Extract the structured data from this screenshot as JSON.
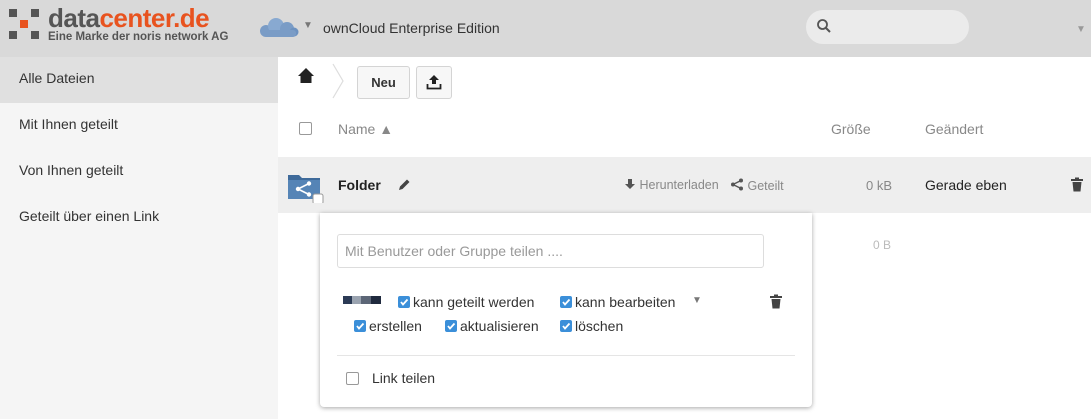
{
  "header": {
    "brand_prefix": "data",
    "brand_accent": "center.de",
    "brand_sub": "Eine Marke der noris network AG",
    "app_title": "ownCloud Enterprise Edition",
    "search_placeholder": "",
    "colors": {
      "accent": "#e8531f",
      "header_bg": "#d9d9d9"
    }
  },
  "sidebar": {
    "items": [
      {
        "label": "Alle Dateien",
        "active": true
      },
      {
        "label": "Mit Ihnen geteilt"
      },
      {
        "label": "Von Ihnen geteilt"
      },
      {
        "label": "Geteilt über einen Link"
      }
    ]
  },
  "controls": {
    "new_label": "Neu",
    "upload_icon": "upload-icon",
    "home_icon": "home-icon"
  },
  "table": {
    "headers": {
      "name": "Name ▲",
      "size": "Größe",
      "modified": "Geändert"
    },
    "rows": [
      {
        "name": "Folder",
        "download_label": "Herunterladen",
        "shared_label": "Geteilt",
        "size": "0 kB",
        "modified": "Gerade eben"
      }
    ],
    "summary_size": "0 B"
  },
  "share": {
    "input_placeholder": "Mit Benutzer oder Gruppe teilen ....",
    "permissions": {
      "can_share": "kann geteilt werden",
      "can_edit": "kann bearbeiten",
      "create": "erstellen",
      "update": "aktualisieren",
      "delete": "löschen"
    },
    "link_share_label": "Link teilen",
    "checkbox_color": "#3b8fd9"
  }
}
